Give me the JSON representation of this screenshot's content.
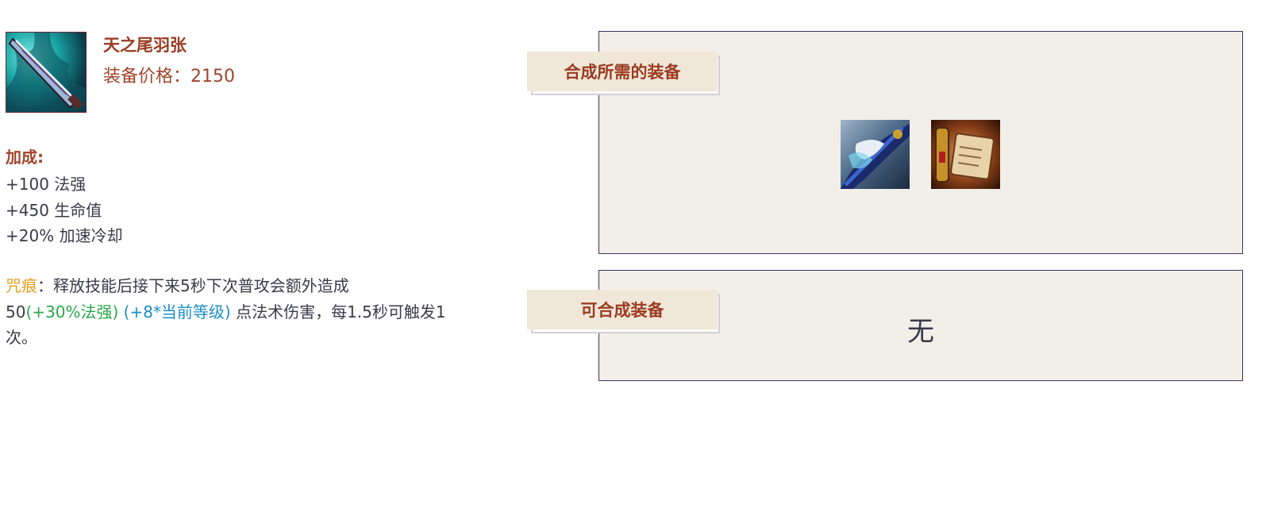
{
  "item": {
    "name": "天之尾羽张",
    "price_label": "装备价格：",
    "price_value": "2150",
    "icon": "sword-icon"
  },
  "bonus": {
    "title": "加成:",
    "stats": [
      "+100 法强",
      "+450 生命值",
      "+20% 加速冷却"
    ]
  },
  "passive": {
    "name": "咒痕",
    "text_a": "：释放技能后接下来5秒下次普攻会额外造成",
    "text_b": "50",
    "green": "(+30%法强)",
    "blue": "(+8*当前等级)",
    "text_c": " 点法术伤害，每1.5秒可触发1次。"
  },
  "required": {
    "label": "合成所需的装备",
    "items": [
      {
        "icon": "frost-blade-icon"
      },
      {
        "icon": "scroll-icon"
      }
    ]
  },
  "craftable": {
    "label": "可合成装备",
    "empty_text": "无"
  },
  "colors": {
    "title_red": "#9a3c22",
    "passive_gold": "#e0a020",
    "scaling_green": "#2aa84a",
    "scaling_blue": "#1a8fc8",
    "panel_bg": "#f2eee8",
    "panel_border": "#3b3466",
    "tag_bg": "#f1e7d8"
  }
}
